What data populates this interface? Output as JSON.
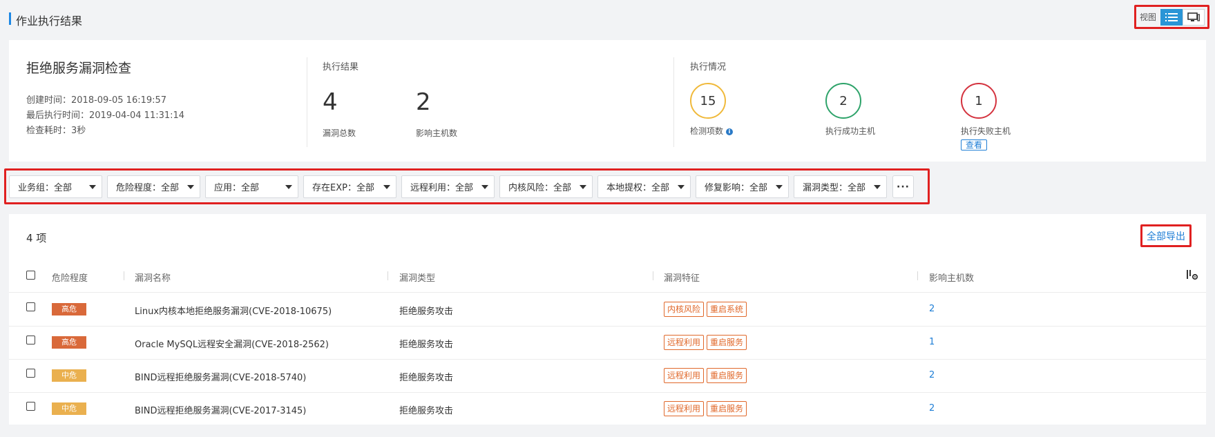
{
  "page": {
    "title": "作业执行结果",
    "view_label": "视图"
  },
  "colors": {
    "accent": "#1e88e5",
    "link": "#1e7ed6",
    "high": "#d9693a",
    "medium": "#eab04f",
    "circle_total": "#f0b93a",
    "circle_success": "#2ea36a",
    "circle_fail": "#d4333f",
    "tag": "#e0682a"
  },
  "summary": {
    "job_name": "拒绝服务漏洞检查",
    "created": "创建时间：2018-09-05 16:19:57",
    "last_run": "最后执行时间：2019-04-04 11:31:14",
    "duration": "检查耗时：3秒",
    "result_label": "执行结果",
    "vuln_total": "4",
    "vuln_total_label": "漏洞总数",
    "affected_hosts": "2",
    "affected_hosts_label": "影响主机数",
    "exec_label": "执行情况",
    "check_items": "15",
    "check_items_label": "检测项数",
    "success_hosts": "2",
    "success_hosts_label": "执行成功主机",
    "fail_hosts": "1",
    "fail_hosts_label": "执行失败主机",
    "view_button": "查看"
  },
  "filters": [
    "业务组：全部",
    "危险程度：全部",
    "应用：全部",
    "存在EXP：全部",
    "远程利用：全部",
    "内核风险：全部",
    "本地提权：全部",
    "修复影响：全部",
    "漏洞类型：全部"
  ],
  "more_button": "···",
  "table": {
    "count": "4 项",
    "export": "全部导出",
    "headers": [
      "危险程度",
      "漏洞名称",
      "漏洞类型",
      "漏洞特征",
      "影响主机数"
    ],
    "rows": [
      {
        "severity": "高危",
        "level": "high",
        "name": "Linux内核本地拒绝服务漏洞(CVE-2018-10675)",
        "type": "拒绝服务攻击",
        "tags": [
          "内核风险",
          "重启系统"
        ],
        "hosts": "2"
      },
      {
        "severity": "高危",
        "level": "high",
        "name": "Oracle MySQL远程安全漏洞(CVE-2018-2562)",
        "type": "拒绝服务攻击",
        "tags": [
          "远程利用",
          "重启服务"
        ],
        "hosts": "1"
      },
      {
        "severity": "中危",
        "level": "medium",
        "name": "BIND远程拒绝服务漏洞(CVE-2018-5740)",
        "type": "拒绝服务攻击",
        "tags": [
          "远程利用",
          "重启服务"
        ],
        "hosts": "2"
      },
      {
        "severity": "中危",
        "level": "medium",
        "name": "BIND远程拒绝服务漏洞(CVE-2017-3145)",
        "type": "拒绝服务攻击",
        "tags": [
          "远程利用",
          "重启服务"
        ],
        "hosts": "2"
      }
    ]
  }
}
